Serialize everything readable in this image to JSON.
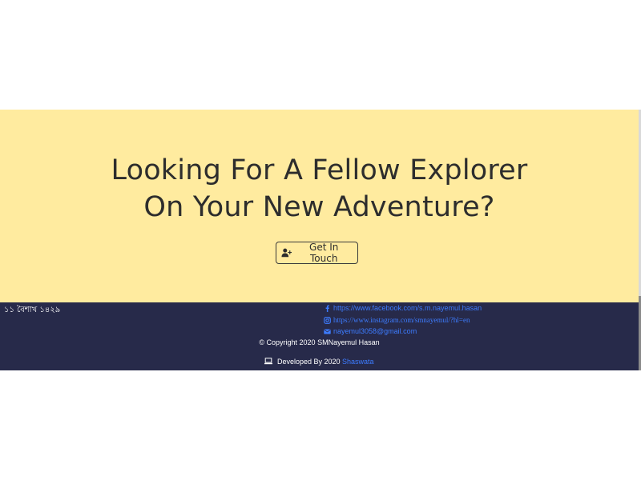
{
  "hero": {
    "title_line1": "Looking For A Fellow Explorer",
    "title_line2": "On Your New Adventure?",
    "cta_label": "Get In Touch",
    "background": "#ffeb9f"
  },
  "footer": {
    "background": "#272a4a",
    "date": "১১ বৈশাখ ১৪২৯",
    "links": {
      "facebook": "https://www.facebook.com/s.m.nayemul.hasan",
      "instagram": "https://www.instagram.com/smnayemul/?hl=en",
      "email": "nayemul3058@gmail.com"
    },
    "copyright": "© Copyright 2020 SMNayemul Hasan",
    "developed_prefix": "Developed By 2020",
    "developer_name": "Shaswata",
    "link_color": "#3d7cff"
  }
}
